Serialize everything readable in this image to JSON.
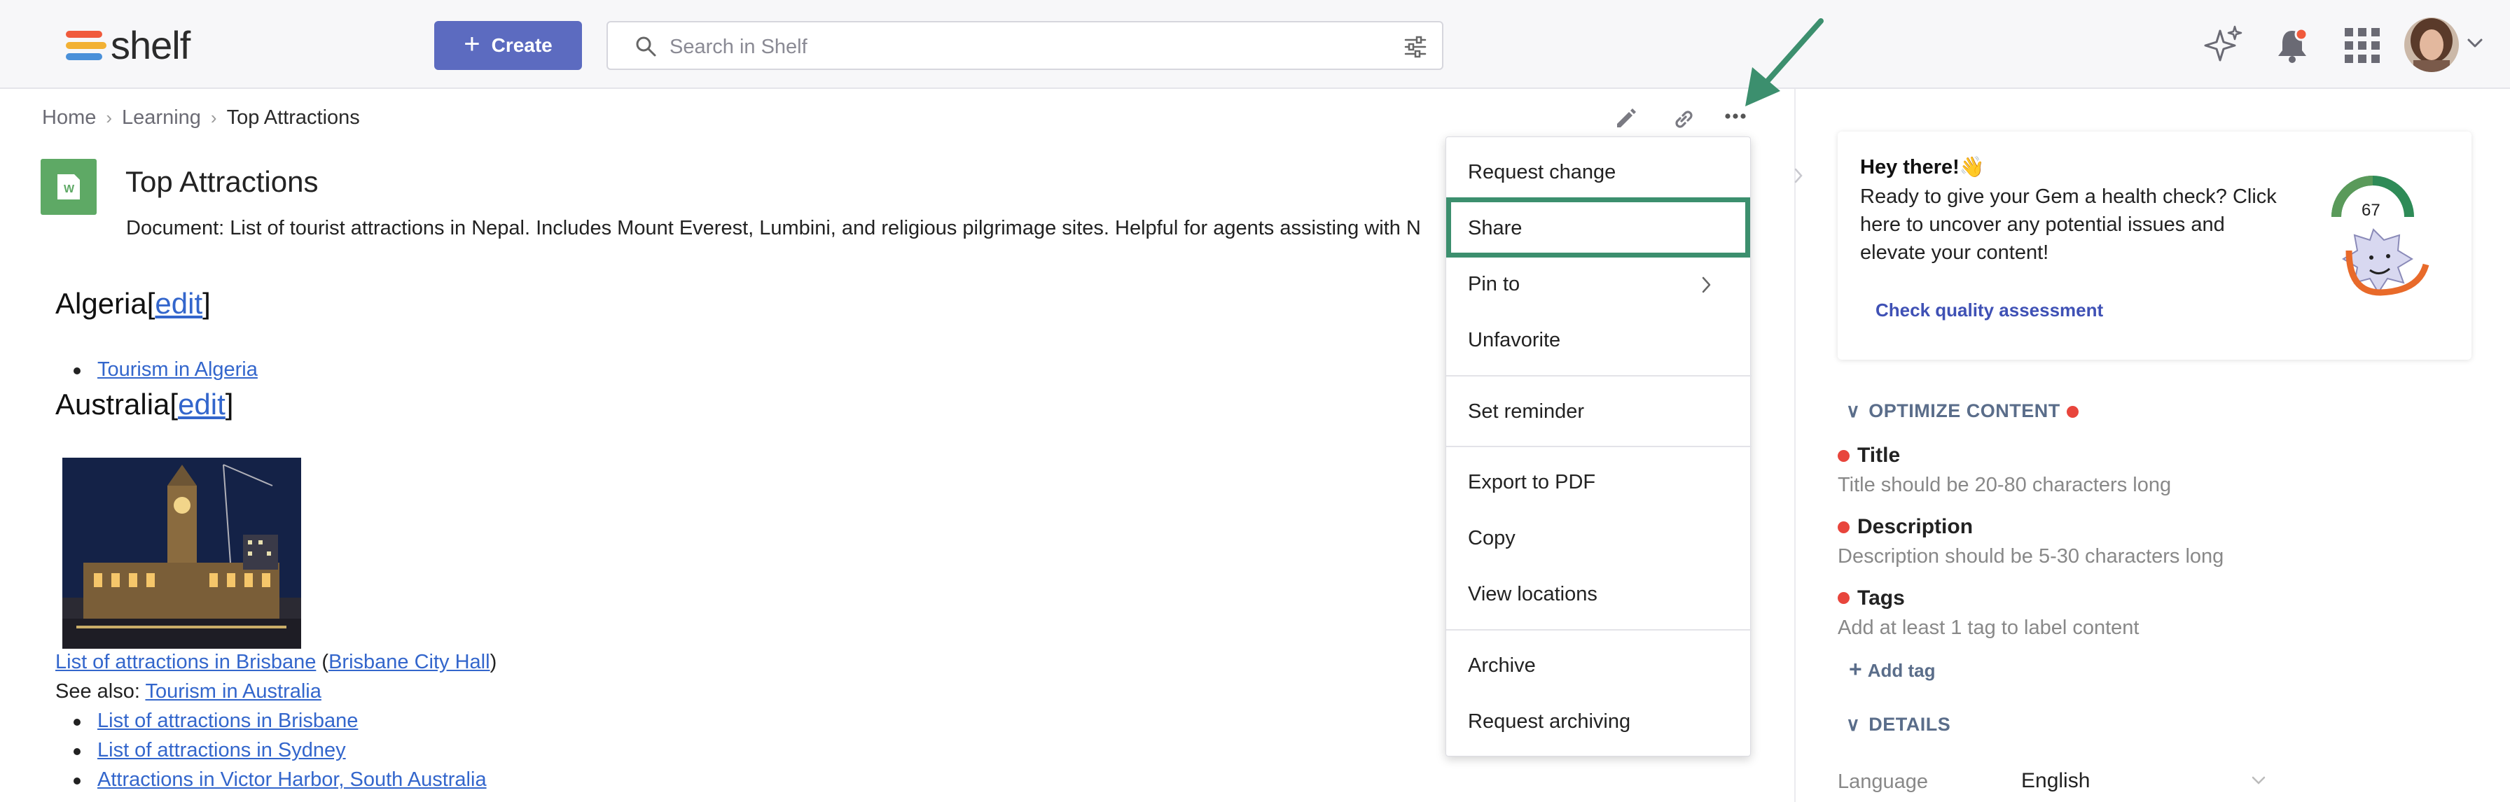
{
  "app": {
    "logo_text": "shelf",
    "brand_colors": [
      "#f05a3c",
      "#f2b134",
      "#4a90d9"
    ]
  },
  "header": {
    "create_label": "Create",
    "search_placeholder": "Search in Shelf",
    "icons": [
      "sparkle-icon",
      "bell-icon",
      "apps-grid-icon",
      "avatar",
      "chevron-down-icon"
    ]
  },
  "breadcrumb": {
    "home": "Home",
    "section": "Learning",
    "current": "Top Attractions"
  },
  "toolbar_icons": [
    "edit-icon",
    "link-icon",
    "more-icon"
  ],
  "document": {
    "title": "Top Attractions",
    "description": "Document: List of tourist attractions in Nepal. Includes Mount Everest, Lumbini, and religious pilgrimage sites. Helpful for agents assisting with N"
  },
  "content": {
    "algeria": {
      "heading": "Algeria",
      "edit_open": "[",
      "edit": "edit",
      "edit_close": "]",
      "items": [
        "Tourism in Algeria"
      ]
    },
    "australia": {
      "heading": "Australia",
      "edit_open": "[",
      "edit": "edit",
      "edit_close": "]",
      "caption_link1": "List of attractions in Brisbane",
      "caption_open": " (",
      "caption_link2": "Brisbane City Hall",
      "caption_close": ")",
      "see_also_label": "See also: ",
      "see_also_link": "Tourism in Australia",
      "items": [
        "List of attractions in Brisbane",
        "List of attractions in Sydney",
        "Attractions in Victor Harbor, South Australia"
      ]
    }
  },
  "menu": {
    "items": [
      "Request change",
      "Share",
      "Pin to",
      "Unfavorite",
      "Set reminder",
      "Export to PDF",
      "Copy",
      "View locations",
      "Archive",
      "Request archiving"
    ],
    "highlight_color": "#3c8f6e"
  },
  "panel": {
    "card": {
      "title": "Hey there!👋",
      "body": "Ready to give your Gem a health check? Click here to uncover any potential issues and elevate your content!",
      "link": "Check quality assessment",
      "score": "67"
    },
    "optimize": {
      "heading": "OPTIMIZE CONTENT",
      "items": [
        {
          "title": "Title",
          "desc": "Title should be 20-80 characters long"
        },
        {
          "title": "Description",
          "desc": "Description should be 5-30 characters long"
        },
        {
          "title": "Tags",
          "desc": "Add at least 1 tag to label content"
        }
      ],
      "add_tag": "Add tag"
    },
    "details": {
      "heading": "DETAILS",
      "language_label": "Language",
      "language_value": "English"
    }
  }
}
